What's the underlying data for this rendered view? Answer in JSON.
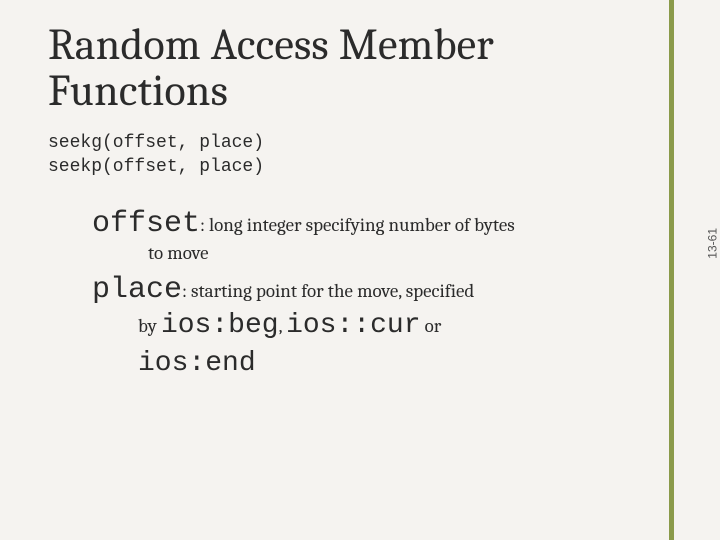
{
  "title": "Random Access Member Functions",
  "signatures": {
    "line1": "seekg(offset, place)",
    "line2": "seekp(offset, place)"
  },
  "defs": {
    "offset": {
      "term": "offset",
      "line1": ": long integer specifying number of bytes",
      "line2": "to move"
    },
    "place": {
      "term": "place",
      "line1": ":  starting point for the move,  specified",
      "by": "by ",
      "code1": "ios:beg",
      "sep1": ", ",
      "code2": "ios::cur",
      "or": " or",
      "code3": "ios:end"
    }
  },
  "page_number": "13-61"
}
